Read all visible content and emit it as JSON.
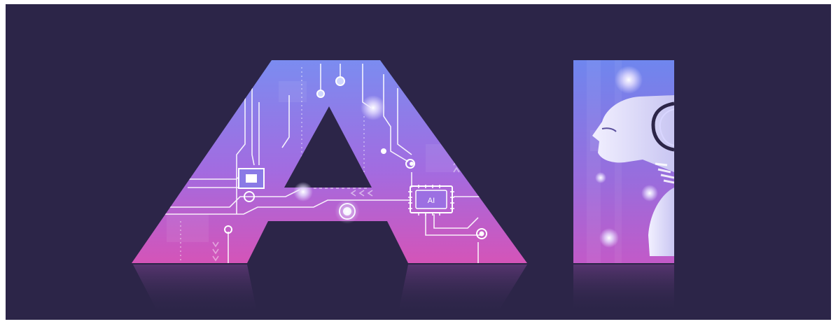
{
  "image": {
    "background_color": "#2c2548",
    "frame_color": "#ffffff",
    "letters": {
      "a": {
        "gradient_top": "#7b8cf0",
        "gradient_mid": "#a36be0",
        "gradient_bottom": "#d454b8"
      },
      "i": {
        "gradient_top": "#6f86ee",
        "gradient_bottom": "#c25ac8"
      }
    },
    "chip_label": "AI",
    "subject": "robot-head-icon",
    "circuit_color": "#ffffff"
  }
}
